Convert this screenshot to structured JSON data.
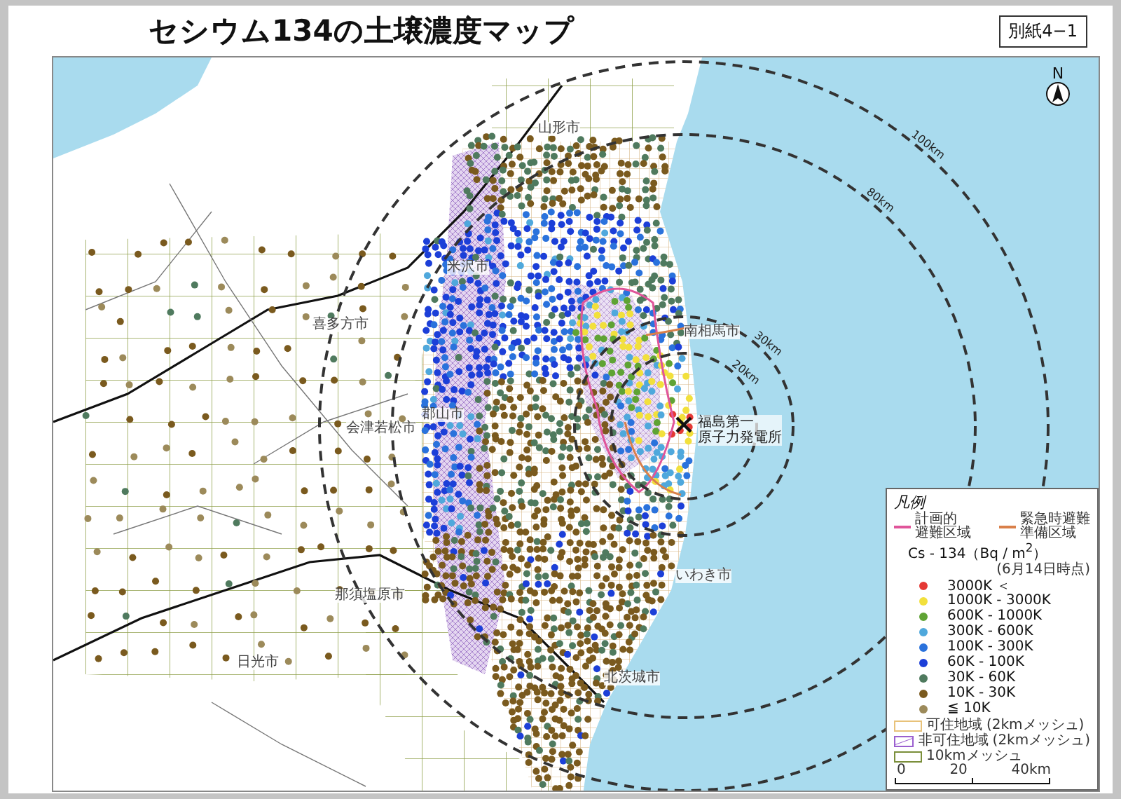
{
  "title": "セシウム134の土壌濃度マップ",
  "annex": "別紙4−1",
  "north_label": "N",
  "rings": [
    {
      "label": "20km"
    },
    {
      "label": "30km"
    },
    {
      "label": "80km"
    },
    {
      "label": "100km"
    }
  ],
  "places": [
    {
      "name": "山形市"
    },
    {
      "name": "米沢市"
    },
    {
      "name": "喜多方市"
    },
    {
      "name": "郡山市"
    },
    {
      "name": "会津若松市"
    },
    {
      "name": "南相馬市"
    },
    {
      "name": "いわき市"
    },
    {
      "name": "那須塩原市"
    },
    {
      "name": "北茨城市"
    },
    {
      "name": "日光市"
    }
  ],
  "plant": {
    "label_lines": [
      "福島第一",
      "原子力発電所"
    ]
  },
  "legend": {
    "title": "凡例",
    "zones": [
      {
        "label_lines": [
          "計画的",
          "避難区域"
        ],
        "color": "#e0559a"
      },
      {
        "label_lines": [
          "緊急時避難",
          "準備区域"
        ],
        "color": "#d9804a"
      }
    ],
    "measure": "Cs - 134（Bq / m$^{2}$）",
    "date": "(6月14日時点)",
    "classes": [
      {
        "label": "3000K ＜",
        "color": "#e53935"
      },
      {
        "label": "1000K - 3000K",
        "color": "#f2e03c"
      },
      {
        "label": "600K - 1000K",
        "color": "#5fa334"
      },
      {
        "label": "300K - 600K",
        "color": "#4fa8dc"
      },
      {
        "label": "100K - 300K",
        "color": "#2a72dc"
      },
      {
        "label": "60K - 100K",
        "color": "#1c3fd8"
      },
      {
        "label": "30K - 60K",
        "color": "#4f7a5e"
      },
      {
        "label": "10K - 30K",
        "color": "#7a5a1e"
      },
      {
        "label": "≦ 10K",
        "color": "#9c8a5a"
      }
    ],
    "meshes": [
      {
        "kind": "habitable",
        "label_lines": [
          "可住地域",
          "(2kmメッシュ)"
        ]
      },
      {
        "kind": "uninhabitable",
        "label_lines": [
          "非可住地域",
          "(2kmメッシュ)"
        ]
      },
      {
        "kind": "grid10",
        "label_lines": [
          "10kmメッシュ"
        ]
      }
    ],
    "scale": {
      "ticks": [
        "0",
        "20",
        "40km"
      ]
    }
  }
}
